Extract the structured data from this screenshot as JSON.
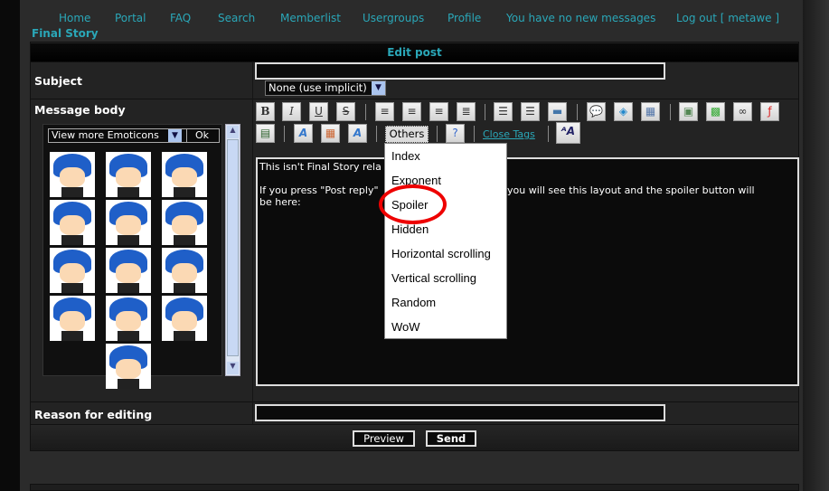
{
  "nav": {
    "items": [
      "Home",
      "Portal",
      "FAQ",
      "Search",
      "Memberlist",
      "Usergroups",
      "Profile",
      "You have no new messages",
      "Log out [ metawe ]"
    ]
  },
  "brand": "Final Story",
  "form": {
    "title": "Edit post",
    "subject_label": "Subject",
    "subject_value": "",
    "post_icon_select": "None (use implicit)",
    "message_label": "Message body",
    "emoticons_select": "View more Emoticons",
    "emoticons_ok": "Ok",
    "toolbar": {
      "bold": "B",
      "italic": "I",
      "underline": "U",
      "strike": "S",
      "others": "Others",
      "close_tags": "Close Tags"
    },
    "message_line1": "This isn't Final Story rela",
    "message_line2a": "If you press \"Post reply\"",
    "message_line2b": "ply you will see this layout and the spoiler button will",
    "message_line3": "be here:",
    "others_menu": [
      "Index",
      "Exponent",
      "Spoiler",
      "Hidden",
      "Horizontal scrolling",
      "Vertical scrolling",
      "Random",
      "WoW"
    ],
    "highlighted_item": "Spoiler",
    "reason_label": "Reason for editing",
    "reason_value": "",
    "preview": "Preview",
    "send": "Send"
  },
  "colors": {
    "link": "#2aa7b8",
    "highlight_circle": "#e00000",
    "background": "#2b2b2b"
  }
}
